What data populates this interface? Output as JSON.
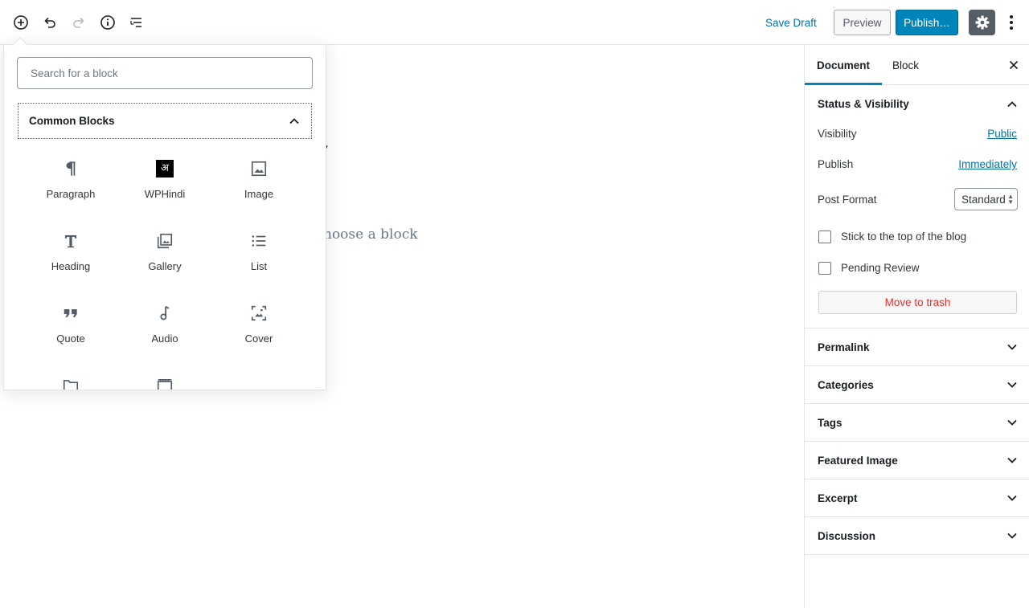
{
  "toolbar": {
    "save_draft": "Save Draft",
    "preview": "Preview",
    "publish": "Publish…"
  },
  "editor": {
    "title_fragment": "t",
    "placeholder_fragment": "hoose a block"
  },
  "inserter": {
    "search_placeholder": "Search for a block",
    "panel_title": "Common Blocks",
    "hindi_glyph": "अ",
    "blocks": [
      {
        "label": "Paragraph",
        "icon": "paragraph-icon"
      },
      {
        "label": "WPHindi",
        "icon": "wphindi-icon"
      },
      {
        "label": "Image",
        "icon": "image-icon"
      },
      {
        "label": "Heading",
        "icon": "heading-icon"
      },
      {
        "label": "Gallery",
        "icon": "gallery-icon"
      },
      {
        "label": "List",
        "icon": "list-icon"
      },
      {
        "label": "Quote",
        "icon": "quote-icon"
      },
      {
        "label": "Audio",
        "icon": "audio-icon"
      },
      {
        "label": "Cover",
        "icon": "cover-icon"
      },
      {
        "label": "",
        "icon": "file-icon"
      },
      {
        "label": "",
        "icon": "video-icon"
      }
    ]
  },
  "sidebar": {
    "tabs": [
      "Document",
      "Block"
    ],
    "status_title": "Status & Visibility",
    "visibility_label": "Visibility",
    "visibility_value": "Public",
    "publish_label": "Publish",
    "publish_value": "Immediately",
    "post_format_label": "Post Format",
    "post_format_value": "Standard",
    "sticky_label": "Stick to the top of the blog",
    "pending_label": "Pending Review",
    "trash_label": "Move to trash",
    "sections": [
      "Permalink",
      "Categories",
      "Tags",
      "Featured Image",
      "Excerpt",
      "Discussion"
    ]
  },
  "colors": {
    "accent": "#0085ba",
    "link": "#0073aa",
    "danger": "#dc3232"
  }
}
